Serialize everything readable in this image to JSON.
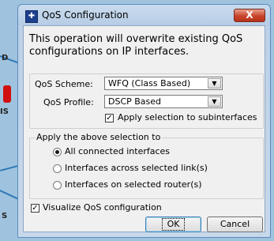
{
  "background": {
    "labels": [
      "D",
      "IS",
      "S"
    ]
  },
  "dialog": {
    "title": "QoS Configuration",
    "close_label": "X",
    "app_icon": "QoS",
    "message": "This operation will overwrite existing QoS configurations on IP interfaces.",
    "scheme_label": "QoS Scheme:",
    "scheme_value": "WFQ (Class Based)",
    "profile_label": "QoS Profile:",
    "profile_value": "DSCP Based",
    "apply_sub_label": "Apply selection to subinterfaces",
    "apply_sub_checked": true,
    "apply_group_title": "Apply the above selection to",
    "options": [
      {
        "label": "All connected interfaces",
        "selected": true
      },
      {
        "label": "Interfaces across selected link(s)",
        "selected": false
      },
      {
        "label": "Interfaces on selected router(s)",
        "selected": false
      }
    ],
    "visualize_label": "Visualize QoS configuration",
    "visualize_checked": true,
    "ok_label": "OK",
    "cancel_label": "Cancel"
  }
}
